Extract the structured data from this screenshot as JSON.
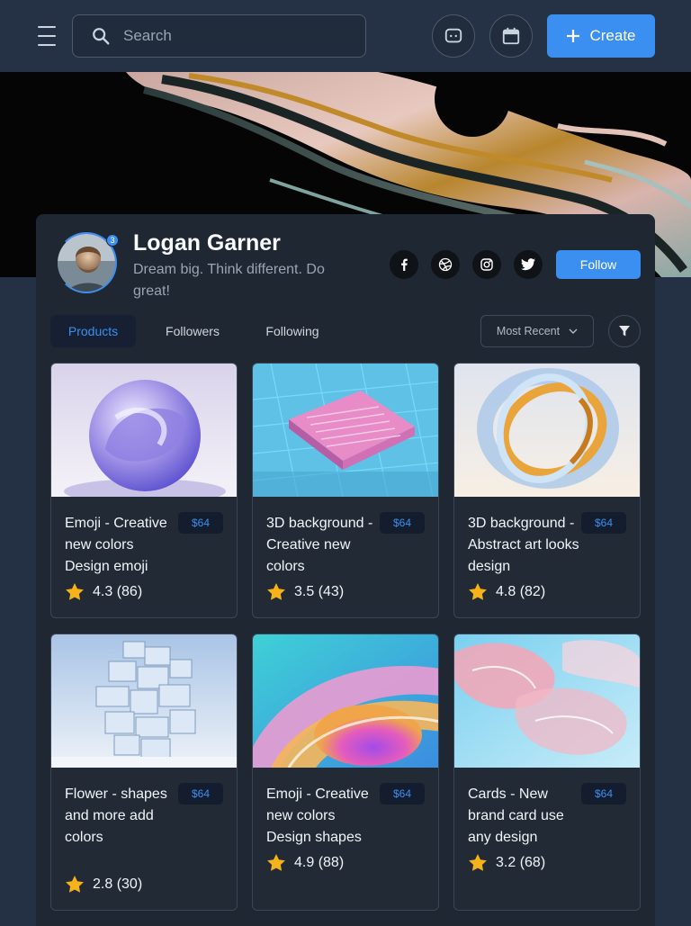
{
  "topbar": {
    "search_placeholder": "Search",
    "create_label": "Create",
    "accent": "#3b8ff0"
  },
  "profile": {
    "name": "Logan Garner",
    "bio": "Dream big. Think different. Do great!",
    "notification_count": "3",
    "follow_label": "Follow",
    "social": [
      "facebook-icon",
      "dribbble-icon",
      "instagram-icon",
      "twitter-icon"
    ]
  },
  "tabs": [
    {
      "label": "Products",
      "active": true
    },
    {
      "label": "Followers",
      "active": false
    },
    {
      "label": "Following",
      "active": false
    }
  ],
  "sort": {
    "selected": "Most Recent"
  },
  "products": [
    {
      "title": "Emoji - Creative new colors Design emoji",
      "price": "$64",
      "rating": "4.3 (86)"
    },
    {
      "title": "3D background - Creative new colors",
      "price": "$64",
      "rating": "3.5 (43)"
    },
    {
      "title": "3D background - Abstract art looks design",
      "price": "$64",
      "rating": "4.8 (82)"
    },
    {
      "title": "Flower - shapes and more add colors",
      "price": "$64",
      "rating": "2.8 (30)"
    },
    {
      "title": "Emoji - Creative new colors Design shapes",
      "price": "$64",
      "rating": "4.9 (88)"
    },
    {
      "title": "Cards - New brand card use any design",
      "price": "$64",
      "rating": "3.2 (68)"
    }
  ]
}
